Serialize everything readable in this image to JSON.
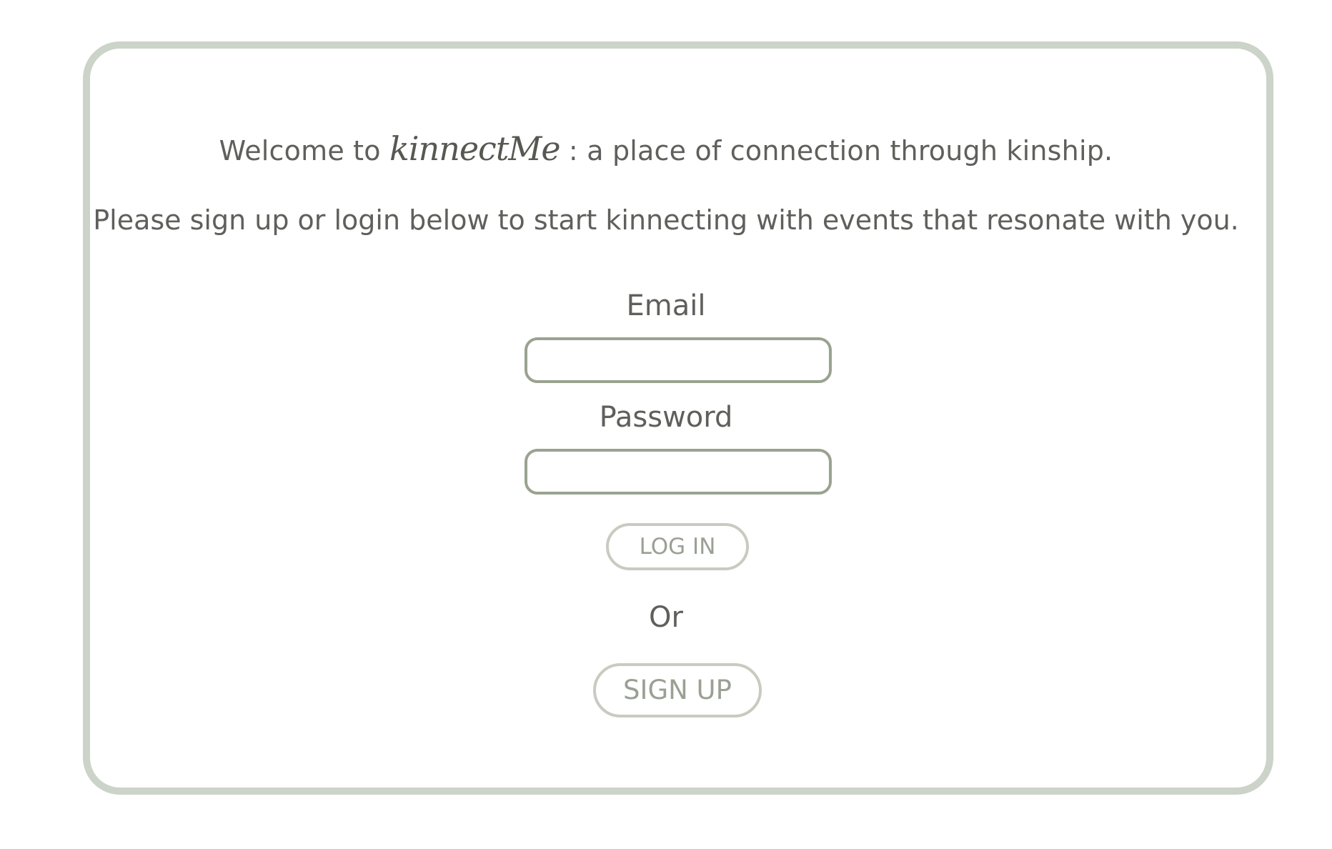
{
  "welcome": {
    "prefix": "Welcome to ",
    "brand": "kinnectMe",
    "suffix": " : a place of connection through kinship."
  },
  "instructions": "Please sign up or login below to start kinnecting with events that resonate with you.",
  "form": {
    "email_label": "Email",
    "email_value": "",
    "password_label": "Password",
    "password_value": "",
    "login_label": "LOG IN",
    "or_text": "Or",
    "signup_label": "SIGN UP"
  },
  "colors": {
    "card_border": "#ccd3c9",
    "input_border": "#99a390",
    "button_border": "#c7cbc0",
    "button_text": "#9aa094",
    "text": "#5f605b"
  }
}
